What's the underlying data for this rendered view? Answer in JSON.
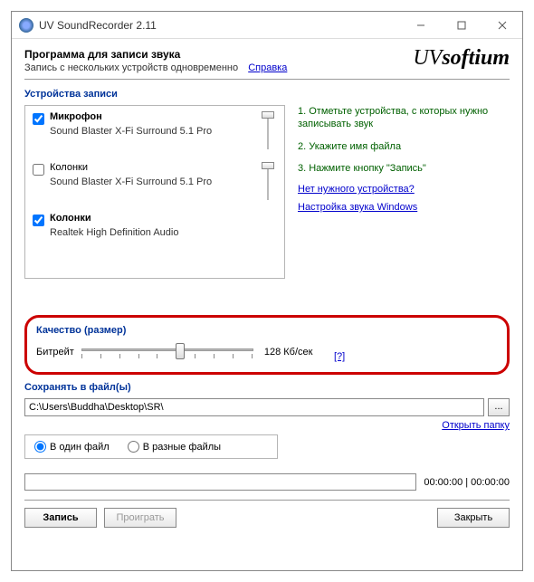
{
  "titlebar": {
    "title": "UV SoundRecorder 2.11"
  },
  "header": {
    "title": "Программа для записи звука",
    "subtitle": "Запись с нескольких устройств одновременно",
    "help_link": "Справка",
    "brand_prefix": "UV",
    "brand_suffix": "softium"
  },
  "devices": {
    "label": "Устройства записи",
    "items": [
      {
        "checked": true,
        "name": "Микрофон",
        "desc": "Sound Blaster X-Fi Surround 5.1 Pro",
        "level": 0
      },
      {
        "checked": false,
        "name": "Колонки",
        "desc": "Sound Blaster X-Fi Surround 5.1 Pro",
        "level": 0
      },
      {
        "checked": true,
        "name": "Колонки",
        "desc": "Realtek High Definition Audio",
        "level": 0
      }
    ]
  },
  "hints": {
    "step1": "1. Отметьте устройства, с которых нужно записывать звук",
    "step2": "2. Укажите имя файла",
    "step3": "3. Нажмите кнопку \"Запись\"",
    "link_no_device": "Нет нужного устройства?",
    "link_win_sound": "Настройка звука Windows"
  },
  "quality": {
    "label": "Качество (размер)",
    "bitrate_label": "Битрейт",
    "bitrate_value": "128 Кб/сек",
    "slider_pos": 0.55,
    "help": "[?]"
  },
  "save": {
    "label": "Сохранять в файл(ы)",
    "path": "C:\\Users\\Buddha\\Desktop\\SR\\",
    "browse": "...",
    "open_folder": "Открыть папку",
    "radio_single": "В один файл",
    "radio_multi": "В разные файлы",
    "radio_value": "single"
  },
  "progress": {
    "time": "00:00:00 | 00:00:00"
  },
  "buttons": {
    "record": "Запись",
    "play": "Проиграть",
    "close": "Закрыть"
  }
}
